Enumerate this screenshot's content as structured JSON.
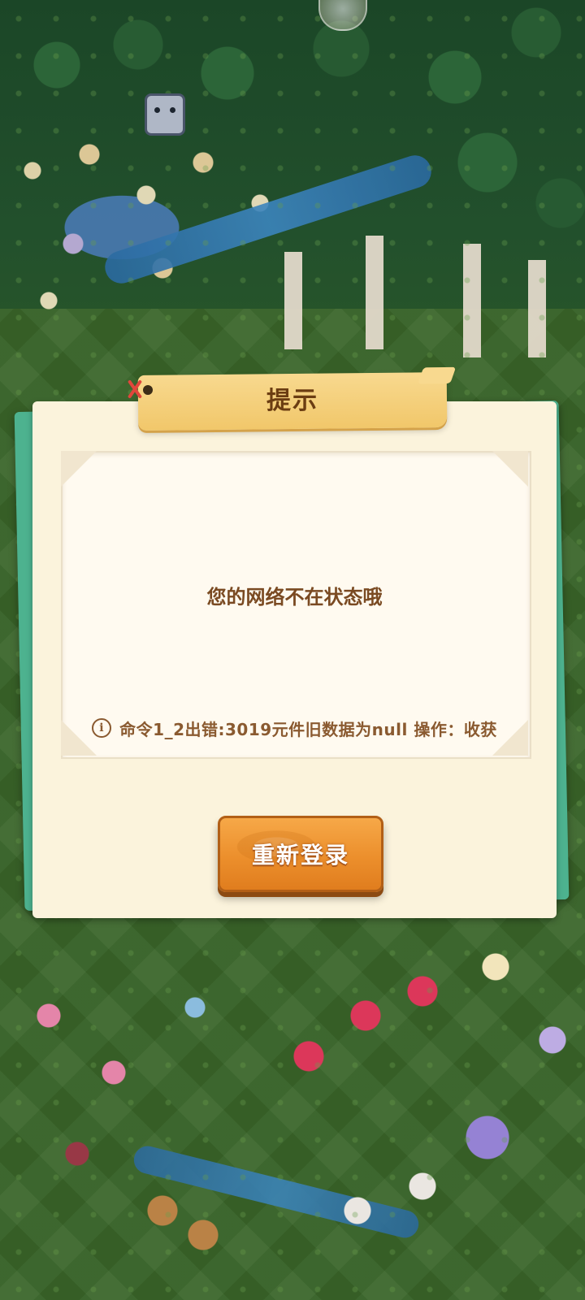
{
  "dialog": {
    "title": "提示",
    "message": "您的网络不在状态哦",
    "error_info": {
      "icon": "info-icon",
      "icon_glyph": "i",
      "text": "命令1_2出错:3019元件旧数据为null 操作：收获"
    },
    "relogin_button": "重新登录"
  },
  "colors": {
    "dialog_bg": "#fbf3dc",
    "dialog_back": "#4db28f",
    "title_tab": "#f1c76a",
    "title_text": "#6b3d12",
    "message_text": "#7a4a22",
    "button_bg": "#ec8f2c"
  }
}
